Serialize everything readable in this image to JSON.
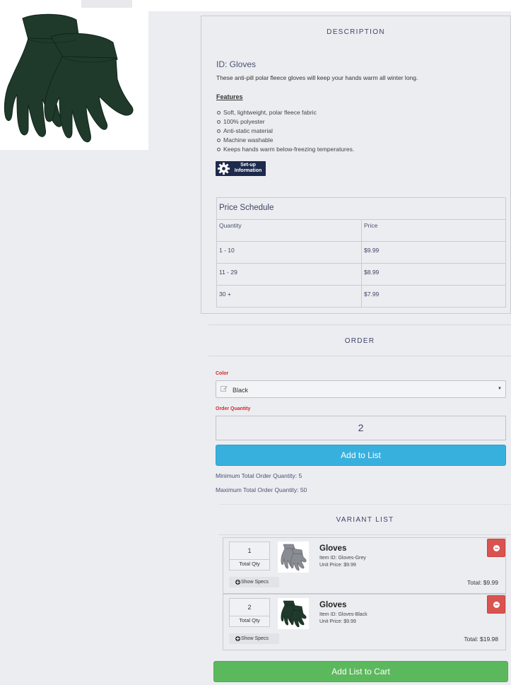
{
  "description": {
    "section_title": "DESCRIPTION",
    "id_line": "ID: Gloves",
    "text": "These anti-pill polar fleece gloves will keep your hands warm all winter long.",
    "features_heading": "Features",
    "features": [
      "Soft, lightweight, polar fleece fabric",
      "100% polyester",
      "Anti-static material",
      "Machine washable",
      "Keeps hands warm below-freezing temperatures."
    ],
    "setup_badge": {
      "line1": "Set-up",
      "line2": "Information",
      "icon": "gear-icon"
    },
    "price_schedule": {
      "title": "Price Schedule",
      "headers": [
        "Quantity",
        "Price"
      ],
      "rows": [
        {
          "qty": "1 - 10",
          "price": "$9.99"
        },
        {
          "qty": "11 - 29",
          "price": "$8.99"
        },
        {
          "qty": "30 +",
          "price": "$7.99"
        }
      ]
    }
  },
  "order": {
    "section_title": "ORDER",
    "color_label": "Color",
    "color_value": "Black",
    "quantity_label": "Order Quantity",
    "quantity_value": "2",
    "add_to_list_label": "Add to List",
    "min_total": "Minimum Total Order Quantity: 5",
    "max_total": "Maximum Total Order Quantity: 50"
  },
  "variant_list": {
    "section_title": "VARIANT LIST",
    "items": [
      {
        "qty": "1",
        "qty_label": "Total Qty",
        "name": "Gloves",
        "item_id": "Item ID: Gloves-Grey",
        "unit_price": "Unit Price: $9.99",
        "specs_label": "Show Specs",
        "total": "Total: $9.99"
      },
      {
        "qty": "2",
        "qty_label": "Total Qty",
        "name": "Gloves",
        "item_id": "Item ID: Gloves-Black",
        "unit_price": "Unit Price: $9.99",
        "specs_label": "Show Specs",
        "total": "Total: $19.98"
      }
    ]
  },
  "add_list_to_cart_label": "Add List to Cart",
  "colors": {
    "accent_blue": "#38b0de",
    "cart_green": "#5cb85c",
    "remove_red": "#d9534f",
    "required_label_red": "#d02a2a",
    "glove_black": "#1f3a2b",
    "glove_grey": "#8a8c93"
  }
}
